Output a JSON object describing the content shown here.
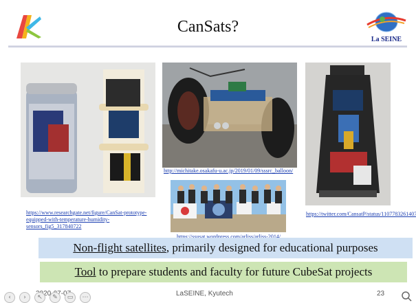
{
  "slide": {
    "title": "CanSats?",
    "right_logo_text": "La SEINE",
    "captions": {
      "left": "https://www.researchgate.net/figure/CanSat-prototype-equipped-with-temperature-humidity-sensors_fig5_317840722",
      "middle": "http://michitake.osakafu-u.ac.jp/2019/01/09/sssrc_balloon/",
      "bottom": "https://ssusat.wordpress.com/arliss/arliss-2014/",
      "right": "https://twitter.com/CansatP/status/1107783261407887360"
    },
    "box1": {
      "underlined": "Non-flight satellites",
      "rest": ", primarily designed for educational purposes"
    },
    "box2": {
      "underlined": "Tool",
      "rest": " to prepare students and faculty for future CubeSat projects"
    },
    "footer": {
      "date": "2020-07-07",
      "center": "LaSEINE, Kyutech",
      "page": "23"
    }
  },
  "icons": {
    "left_logo": "laseine-k-logo",
    "right_logo": "laseine-globe-logo",
    "toolbar": [
      "back-icon",
      "forward-icon",
      "pointer-icon",
      "pen-icon",
      "view-icon",
      "more-icon"
    ],
    "zoom": "zoom-icon"
  }
}
